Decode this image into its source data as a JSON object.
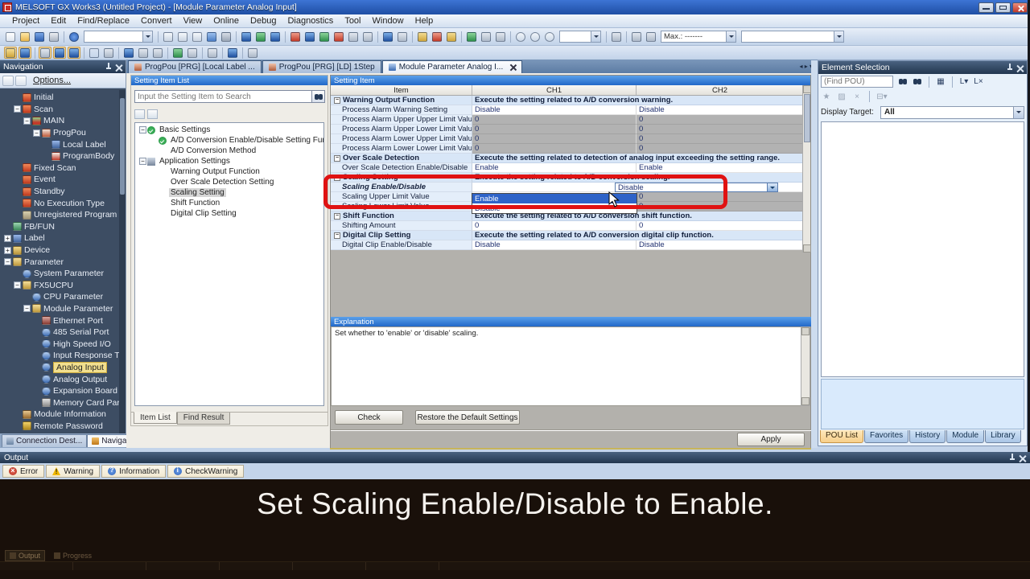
{
  "window": {
    "title": "MELSOFT GX Works3 (Untitled Project) - [Module Parameter Analog Input]",
    "menus": [
      "Project",
      "Edit",
      "Find/Replace",
      "Convert",
      "View",
      "Online",
      "Debug",
      "Diagnostics",
      "Tool",
      "Window",
      "Help"
    ],
    "toolbar_main": [
      {
        "icon": "new-file-icon"
      },
      {
        "icon": "open-folder-icon"
      },
      {
        "icon": "save-icon"
      },
      {
        "icon": "print-icon"
      },
      {
        "sep": true
      },
      {
        "icon": "help-icon"
      },
      {
        "combo": true,
        "w": 86,
        "label": ""
      },
      {
        "sep": true
      },
      {
        "icon": "cut-icon"
      },
      {
        "icon": "copy-icon"
      },
      {
        "icon": "paste-icon"
      },
      {
        "icon": "undo-icon"
      },
      {
        "icon": "redo-icon"
      },
      {
        "sep": true
      },
      {
        "icon": "write-to-plc-icon",
        "plc": "b"
      },
      {
        "icon": "read-from-plc-icon",
        "plc": "g"
      },
      {
        "icon": "verify-with-plc-icon",
        "plc": "b"
      },
      {
        "sep": true
      },
      {
        "icon": "device-write-icon",
        "plc": "r"
      },
      {
        "icon": "device-read-icon",
        "plc": "b"
      },
      {
        "icon": "monitor-mode-icon",
        "plc": "g"
      },
      {
        "icon": "monitor-write-icon",
        "plc": "r"
      },
      {
        "icon": "monitor-read-icon",
        "plc": "x"
      },
      {
        "icon": "monitor-stop-icon",
        "plc": "x"
      },
      {
        "sep": true
      },
      {
        "icon": "simulation-start-icon",
        "plc": "b"
      },
      {
        "icon": "simulation-stop-icon",
        "plc": "x"
      },
      {
        "sep": true
      },
      {
        "icon": "online-change-icon",
        "plc": "y"
      },
      {
        "icon": "transfer-setup-icon",
        "plc": "r"
      },
      {
        "icon": "ladder-edit-icon",
        "plc": "y"
      },
      {
        "sep": true
      },
      {
        "icon": "insert-row-icon",
        "plc": "g"
      },
      {
        "icon": "delete-row-icon",
        "plc": "x"
      },
      {
        "icon": "edit-block-icon",
        "plc": "x"
      },
      {
        "sep": true
      },
      {
        "icon": "zoom-in-icon"
      },
      {
        "icon": "zoom-out-icon"
      },
      {
        "icon": "zoom-fit-icon"
      },
      {
        "combo": true,
        "w": 52,
        "label": ""
      },
      {
        "sep": true
      },
      {
        "icon": "docking-window-icon",
        "plc": "x"
      },
      {
        "sep": true
      },
      {
        "icon": "check-circle-1-icon",
        "plc": "x"
      },
      {
        "icon": "check-circle-2-icon",
        "plc": "x"
      },
      {
        "combo": true,
        "w": 94,
        "label": "Max.: -------"
      },
      {
        "combo": true,
        "w": 128,
        "label": ""
      }
    ],
    "toolbar_sub": [
      {
        "icon": "tree-view-icon",
        "on": true,
        "plc": "y"
      },
      {
        "icon": "save-view-icon",
        "on": true,
        "plc": "b"
      },
      {
        "sep": true
      },
      {
        "icon": "device-comment-icon",
        "on": true,
        "plc": "x"
      },
      {
        "icon": "statement-display-icon",
        "on": true,
        "plc": "b"
      },
      {
        "icon": "note-display-icon",
        "on": true,
        "plc": "b"
      },
      {
        "sep": true
      },
      {
        "icon": "find-icon"
      },
      {
        "icon": "find-replace-icon",
        "plc": "x"
      },
      {
        "sep": true
      },
      {
        "icon": "cross-reference-icon",
        "plc": "b"
      },
      {
        "icon": "device-list-icon",
        "plc": "x"
      },
      {
        "icon": "watch-icon",
        "plc": "x"
      },
      {
        "sep": true
      },
      {
        "icon": "register-watch-icon",
        "plc": "g"
      },
      {
        "icon": "intelligent-module-icon",
        "plc": "x"
      },
      {
        "sep": true
      },
      {
        "icon": "spell-check-icon",
        "plc": "x"
      },
      {
        "sep": true
      },
      {
        "icon": "program-check-icon",
        "plc": "b"
      },
      {
        "sep": true
      },
      {
        "icon": "help-find-icon",
        "plc": "x"
      }
    ]
  },
  "doc_tabs": [
    {
      "label": "ProgPou [PRG] [Local Label ...",
      "icon": "local-label-tab-icon",
      "active": false
    },
    {
      "label": "ProgPou [PRG] [LD] 1Step",
      "icon": "ladder-tab-icon",
      "active": false
    },
    {
      "label": "Module Parameter Analog I...",
      "icon": "module-param-tab-icon",
      "active": true
    }
  ],
  "navigation": {
    "title": "Navigation",
    "options_label": "Options...",
    "tree": [
      {
        "label": "Initial",
        "lvl": 2,
        "icon": "task-red"
      },
      {
        "label": "Scan",
        "lvl": 2,
        "icon": "task-red",
        "exp": "-"
      },
      {
        "label": "MAIN",
        "lvl": 3,
        "icon": "main",
        "exp": "-"
      },
      {
        "label": "ProgPou",
        "lvl": 4,
        "icon": "pou",
        "exp": "-"
      },
      {
        "label": "Local Label",
        "lvl": 5,
        "icon": "label-blue"
      },
      {
        "label": "ProgramBody",
        "lvl": 5,
        "icon": "body-red"
      },
      {
        "label": "Fixed Scan",
        "lvl": 2,
        "icon": "task-red"
      },
      {
        "label": "Event",
        "lvl": 2,
        "icon": "task-red"
      },
      {
        "label": "Standby",
        "lvl": 2,
        "icon": "task-red"
      },
      {
        "label": "No Execution Type",
        "lvl": 2,
        "icon": "task-red"
      },
      {
        "label": "Unregistered Program",
        "lvl": 2,
        "icon": "task-gray"
      },
      {
        "label": "FB/FUN",
        "lvl": 1,
        "icon": "fb-green"
      },
      {
        "label": "Label",
        "lvl": 1,
        "icon": "label-blue",
        "exp": "+"
      },
      {
        "label": "Device",
        "lvl": 1,
        "icon": "dev-gold",
        "exp": "+"
      },
      {
        "label": "Parameter",
        "lvl": 1,
        "icon": "param-gold",
        "exp": "-"
      },
      {
        "label": "System Parameter",
        "lvl": 2,
        "icon": "gear-blue"
      },
      {
        "label": "FX5UCPU",
        "lvl": 2,
        "icon": "param-gold",
        "exp": "-"
      },
      {
        "label": "CPU Parameter",
        "lvl": 3,
        "icon": "gear-blue"
      },
      {
        "label": "Module Parameter",
        "lvl": 3,
        "icon": "param-gold",
        "exp": "-"
      },
      {
        "label": "Ethernet Port",
        "lvl": 4,
        "icon": "eth-red"
      },
      {
        "label": "485 Serial Port",
        "lvl": 4,
        "icon": "gear-blue"
      },
      {
        "label": "High Speed I/O",
        "lvl": 4,
        "icon": "gear-blue"
      },
      {
        "label": "Input Response Tir",
        "lvl": 4,
        "icon": "gear-blue"
      },
      {
        "label": "Analog Input",
        "lvl": 4,
        "icon": "gear-blue",
        "selected": true
      },
      {
        "label": "Analog Output",
        "lvl": 4,
        "icon": "gear-blue"
      },
      {
        "label": "Expansion Board",
        "lvl": 4,
        "icon": "gear-blue"
      },
      {
        "label": "Memory Card Param",
        "lvl": 4,
        "icon": "mem-gray"
      },
      {
        "label": "Module Information",
        "lvl": 2,
        "icon": "info-brown"
      },
      {
        "label": "Remote Password",
        "lvl": 2,
        "icon": "key-gold"
      }
    ],
    "bottom_tabs": [
      {
        "label": "Connection Dest...",
        "active": false
      },
      {
        "label": "Navigation",
        "active": true
      }
    ]
  },
  "setting_list": {
    "title": "Setting Item List",
    "search_placeholder": "Input the Setting Item to Search",
    "tree": [
      {
        "label": "Basic Settings",
        "lvl": 0,
        "icon": "check",
        "exp": "-"
      },
      {
        "label": "A/D Conversion Enable/Disable Setting Function",
        "lvl": 1,
        "icon": "check"
      },
      {
        "label": "A/D Conversion Method",
        "lvl": 1
      },
      {
        "label": "Application Settings",
        "lvl": 0,
        "icon": "app",
        "exp": "-"
      },
      {
        "label": "Warning Output Function",
        "lvl": 1
      },
      {
        "label": "Over Scale Detection Setting",
        "lvl": 1
      },
      {
        "label": "Scaling Setting",
        "lvl": 1,
        "selected": true
      },
      {
        "label": "Shift Function",
        "lvl": 1
      },
      {
        "label": "Digital Clip Setting",
        "lvl": 1
      }
    ],
    "tabs": [
      {
        "label": "Item List",
        "active": true
      },
      {
        "label": "Find Result",
        "active": false
      }
    ]
  },
  "setting_item": {
    "title": "Setting Item",
    "columns": [
      "Item",
      "CH1",
      "CH2"
    ],
    "rows": [
      {
        "kind": "group",
        "item": "Warning Output Function",
        "desc": "Execute the setting related to A/D conversion warning."
      },
      {
        "kind": "value",
        "item": "Process Alarm Warning Setting",
        "ch1": "Disable",
        "ch2": "Disable"
      },
      {
        "kind": "value",
        "item": "Process Alarm Upper Upper Limit Value",
        "ch1": "0",
        "ch2": "0",
        "ch1_gray": true,
        "ch2_gray": true
      },
      {
        "kind": "value",
        "item": "Process Alarm Upper Lower Limit Value",
        "ch1": "0",
        "ch2": "0",
        "ch1_gray": true,
        "ch2_gray": true
      },
      {
        "kind": "value",
        "item": "Process Alarm Lower Upper Limit Value",
        "ch1": "0",
        "ch2": "0",
        "ch1_gray": true,
        "ch2_gray": true
      },
      {
        "kind": "value",
        "item": "Process Alarm Lower Lower Limit Value",
        "ch1": "0",
        "ch2": "0",
        "ch1_gray": true,
        "ch2_gray": true
      },
      {
        "kind": "group",
        "item": "Over Scale Detection",
        "desc": "Execute the setting related to detection of analog input exceeding the setting range."
      },
      {
        "kind": "value",
        "item": "Over Scale Detection Enable/Disable",
        "ch1": "Enable",
        "ch2": "Enable"
      },
      {
        "kind": "group",
        "item": "Scaling Setting",
        "desc": "Execute the setting related to A/D conversion scaling."
      },
      {
        "kind": "value",
        "item": "Scaling Enable/Disable",
        "ch1": "",
        "ch2": "Disable",
        "combo": true,
        "emph": true
      },
      {
        "kind": "value",
        "item": "Scaling Upper Limit Value",
        "ch1": "",
        "ch2": "0",
        "ch2_gray": true
      },
      {
        "kind": "value",
        "item": "Scaling Lower Limit Value",
        "ch1": "",
        "ch2": "0",
        "ch2_gray": true
      },
      {
        "kind": "group",
        "item": "Shift Function",
        "desc": "Execute the setting related to A/D conversion shift function."
      },
      {
        "kind": "value",
        "item": "Shifting Amount",
        "ch1": "0",
        "ch2": "0"
      },
      {
        "kind": "group",
        "item": "Digital Clip Setting",
        "desc": "Execute the setting related to A/D conversion digital clip function."
      },
      {
        "kind": "value",
        "item": "Digital Clip Enable/Disable",
        "ch1": "Disable",
        "ch2": "Disable"
      }
    ],
    "combo": {
      "value": "Disable",
      "options": [
        {
          "label": "Enable",
          "highlighted": true
        },
        {
          "label": "Disable",
          "highlighted": false
        }
      ]
    },
    "explanation": {
      "title": "Explanation",
      "text": "Set whether to 'enable' or 'disable' scaling."
    },
    "check_label": "Check",
    "restore_label": "Restore the Default Settings",
    "apply_label": "Apply",
    "annotation_color": "#e01212"
  },
  "element_selection": {
    "title": "Element Selection",
    "find_placeholder": "(Find POU)",
    "display_target_label": "Display Target:",
    "display_target_value": "All",
    "tabs": [
      {
        "label": "POU List",
        "active": true
      },
      {
        "label": "Favorites",
        "active": false
      },
      {
        "label": "History",
        "active": false
      },
      {
        "label": "Module",
        "active": false
      },
      {
        "label": "Library",
        "active": false
      }
    ]
  },
  "output_panel": {
    "title": "Output",
    "filters": [
      {
        "label": "Error",
        "icon": "error"
      },
      {
        "label": "Warning",
        "icon": "warning"
      },
      {
        "label": "Information",
        "icon": "information"
      },
      {
        "label": "CheckWarning",
        "icon": "checkwarning"
      }
    ]
  },
  "caption": {
    "text": "Set Scaling Enable/Disable to Enable."
  },
  "statusbar_tabs": [
    "Output",
    "Progress"
  ]
}
